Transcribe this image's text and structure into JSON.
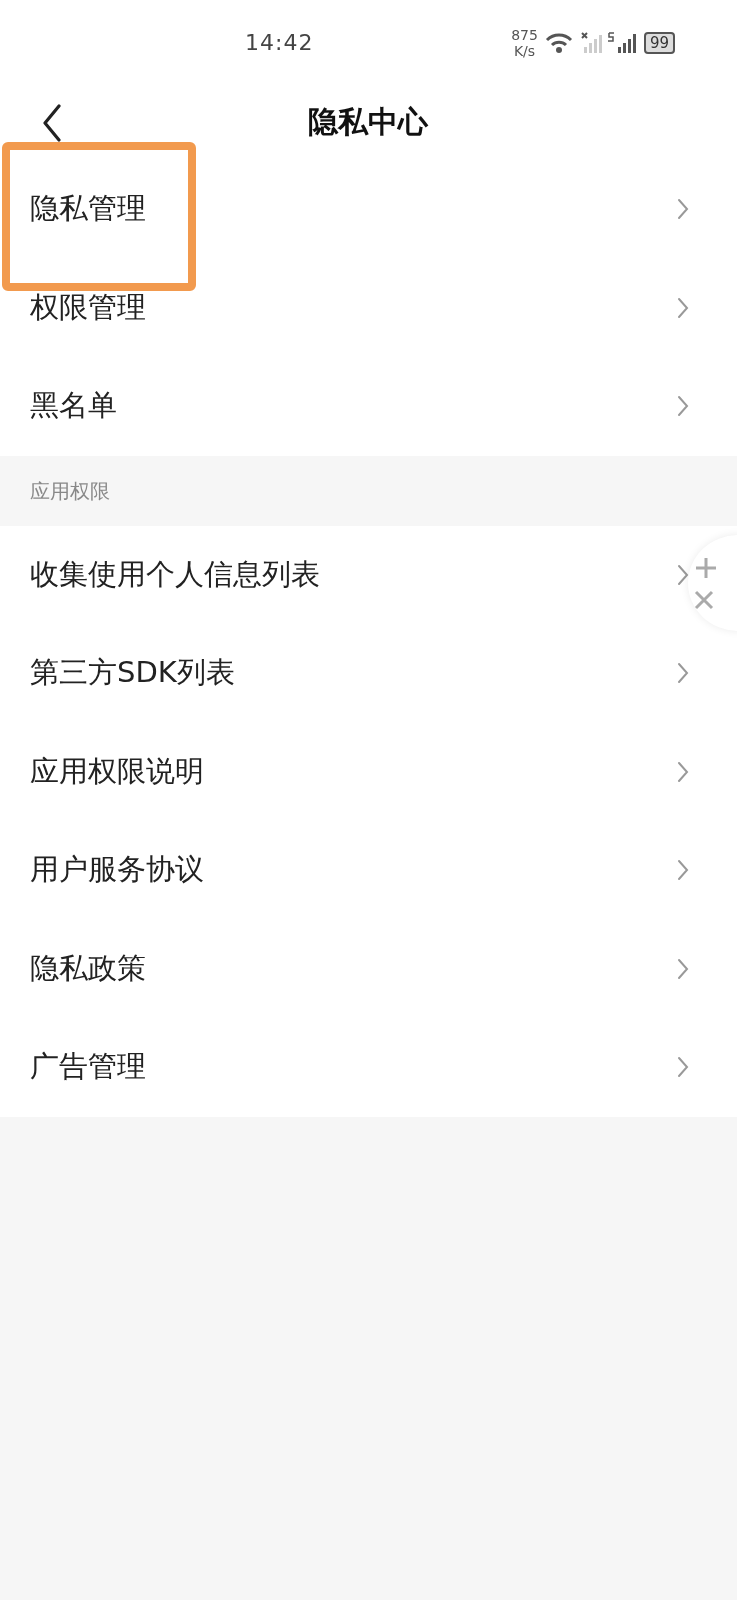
{
  "status_bar": {
    "time": "14:42",
    "net_speed": "875",
    "net_unit": "K/s",
    "battery": "99"
  },
  "header": {
    "title": "隐私中心"
  },
  "sections": [
    {
      "items": [
        {
          "label": "隐私管理",
          "highlighted": true
        },
        {
          "label": "权限管理",
          "highlighted": false
        },
        {
          "label": "黑名单",
          "highlighted": false
        }
      ]
    },
    {
      "label": "应用权限",
      "items": [
        {
          "label": "收集使用个人信息列表",
          "highlighted": false
        },
        {
          "label": "第三方SDK列表",
          "highlighted": false
        },
        {
          "label": "应用权限说明",
          "highlighted": false
        },
        {
          "label": "用户服务协议",
          "highlighted": false
        },
        {
          "label": "隐私政策",
          "highlighted": false
        },
        {
          "label": "广告管理",
          "highlighted": false
        }
      ]
    }
  ]
}
